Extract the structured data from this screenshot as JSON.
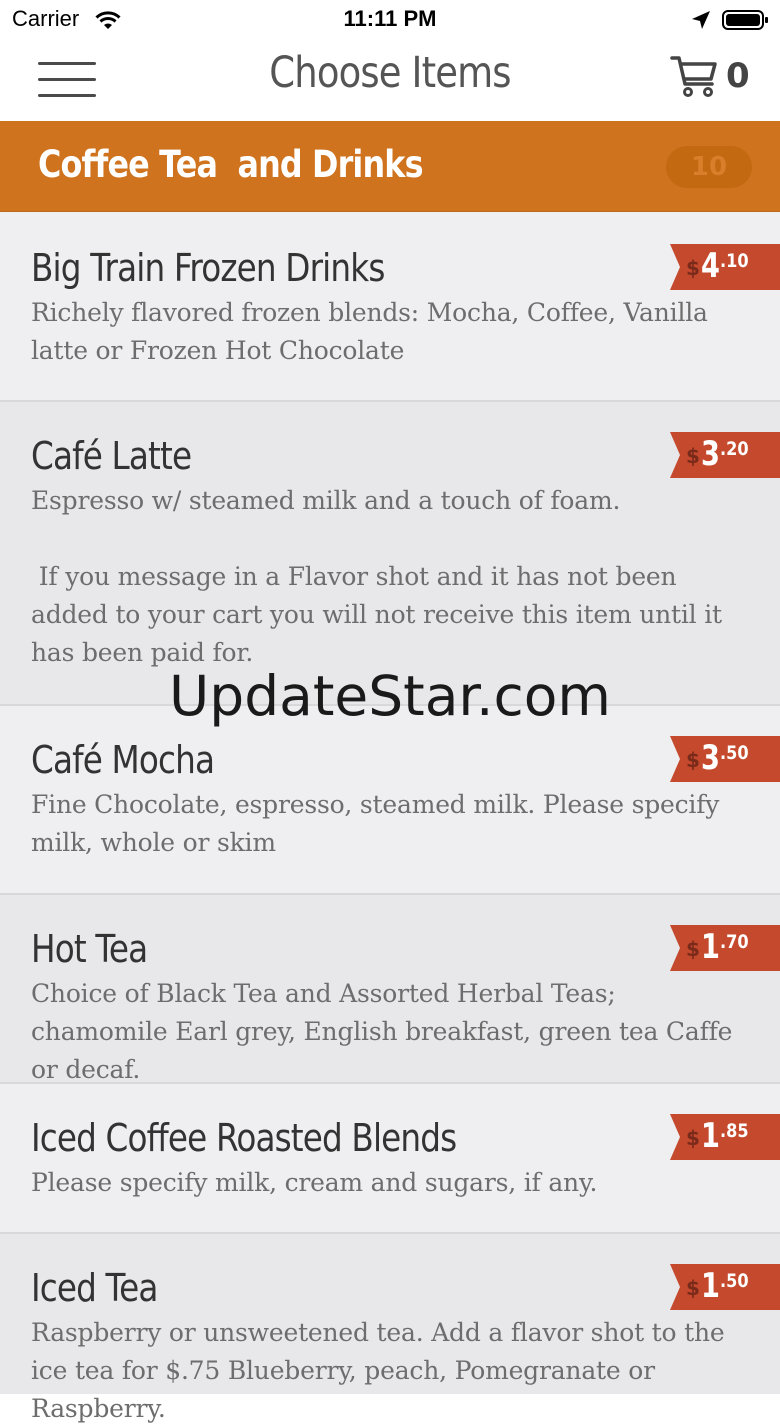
{
  "status": {
    "carrier": "Carrier",
    "time": "11:11 PM",
    "icons": [
      "wifi-icon",
      "location-arrow-icon",
      "battery-icon"
    ]
  },
  "nav": {
    "title": "Choose Items",
    "cart_count": "0",
    "icons": [
      "hamburger-menu-icon",
      "cart-icon"
    ]
  },
  "category": {
    "title": "Coffee Tea  and Drinks",
    "count": "10",
    "color": "#cf731f"
  },
  "items": [
    {
      "name": "Big Train Frozen Drinks",
      "description": "Richely flavored frozen blends: Mocha, Coffee, Vanilla latte or Frozen Hot Chocolate",
      "price_dollar": "$",
      "price_whole": "4",
      "price_cents": ".10"
    },
    {
      "name": "Café Latte",
      "description": "Espresso w/ steamed milk and a touch of foam.\n\n If you message in a Flavor shot and it has not been added to your cart you will not receive this item until it has been paid for.",
      "price_dollar": "$",
      "price_whole": "3",
      "price_cents": ".20"
    },
    {
      "name": "Café Mocha",
      "description": "Fine Chocolate, espresso, steamed milk. Please specify milk, whole or skim",
      "price_dollar": "$",
      "price_whole": "3",
      "price_cents": ".50"
    },
    {
      "name": "Hot Tea",
      "description": "Choice of Black Tea and Assorted Herbal Teas; chamomile Earl grey, English breakfast, green tea Caffe or decaf.",
      "price_dollar": "$",
      "price_whole": "1",
      "price_cents": ".70"
    },
    {
      "name": "Iced Coffee Roasted Blends",
      "description": "Please specify milk, cream and sugars, if any.",
      "price_dollar": "$",
      "price_whole": "1",
      "price_cents": ".85"
    },
    {
      "name": "Iced Tea",
      "description": "Raspberry or unsweetened tea. Add a flavor shot to the ice tea for $.75 Blueberry, peach, Pomegranate or Raspberry.",
      "price_dollar": "$",
      "price_whole": "1",
      "price_cents": ".50"
    }
  ],
  "watermark": "UpdateStar.com",
  "colors": {
    "price_tag": "#c4492d",
    "row_light": "#efeff2",
    "row_dark": "#e8e8eb"
  }
}
